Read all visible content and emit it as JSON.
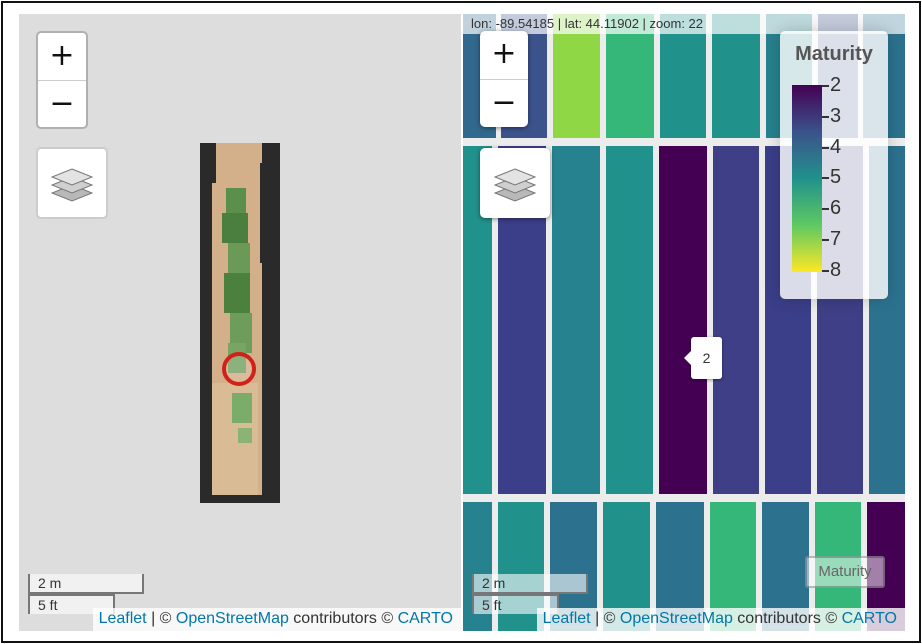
{
  "left_map": {
    "zoom_in": "+",
    "zoom_out": "−",
    "layers_icon": "layers-icon",
    "scale_metric": "2 m",
    "scale_imperial": "5 ft",
    "attribution": {
      "leaflet": "Leaflet",
      "sep1": " | © ",
      "osm": "OpenStreetMap",
      "contrib": " contributors © ",
      "carto": "CARTO"
    },
    "marker_color": "#d0221a"
  },
  "right_map": {
    "coords": "lon: -89.54185 | lat: 44.11902 | zoom: 22",
    "zoom_in": "+",
    "zoom_out": "−",
    "layers_icon": "layers-icon",
    "legend": {
      "title": "Maturity",
      "ticks": [
        "2",
        "3",
        "4",
        "5",
        "6",
        "7",
        "8"
      ],
      "colors": [
        "#440154",
        "#3b528b",
        "#21918c",
        "#5ec962",
        "#fde725"
      ]
    },
    "tooltip": "2",
    "layer_toggle": "Maturity",
    "scale_metric": "2 m",
    "scale_imperial": "5 ft",
    "attribution": {
      "leaflet": "Leaflet",
      "sep1": " | © ",
      "osm": "OpenStreetMap",
      "contrib": " contributors © ",
      "carto": "CARTO"
    },
    "plot_maturity_values": {
      "row_top": [
        4,
        7,
        5,
        4,
        4,
        4,
        4,
        3
      ],
      "row_middle": [
        4,
        3,
        4,
        4,
        2,
        3,
        3,
        3,
        4
      ],
      "row_bottom": [
        4,
        4,
        4,
        4,
        4,
        5,
        5,
        5,
        2
      ]
    }
  }
}
